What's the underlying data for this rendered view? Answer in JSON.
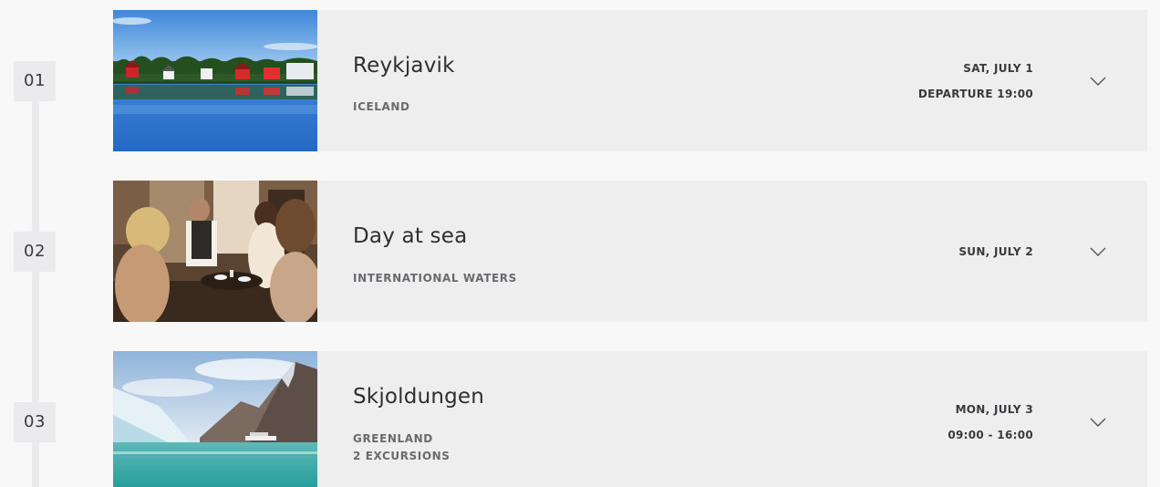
{
  "itinerary": [
    {
      "day": "01",
      "name": "Reykjavik",
      "subtitle_lines": [
        "ICELAND"
      ],
      "date_lines": [
        "SAT, JULY 1",
        "DEPARTURE 19:00"
      ],
      "image": "lake-village-photo"
    },
    {
      "day": "02",
      "name": "Day at sea",
      "subtitle_lines": [
        "INTERNATIONAL WATERS"
      ],
      "date_lines": [
        "SUN, JULY 2"
      ],
      "image": "lounge-people-photo"
    },
    {
      "day": "03",
      "name": "Skjoldungen",
      "subtitle_lines": [
        "GREENLAND",
        "2 EXCURSIONS"
      ],
      "date_lines": [
        "MON, JULY 3",
        "09:00 - 16:00"
      ],
      "image": "iceberg-fjord-photo"
    }
  ],
  "icons": {
    "expand": "chevron-down-icon"
  },
  "colors": {
    "card_bg": "#eeeeef",
    "page_bg": "#f8f8f9",
    "badge_bg": "#ebebed",
    "title_text": "#2f2f31",
    "subtitle_text": "#6a6a6d"
  }
}
